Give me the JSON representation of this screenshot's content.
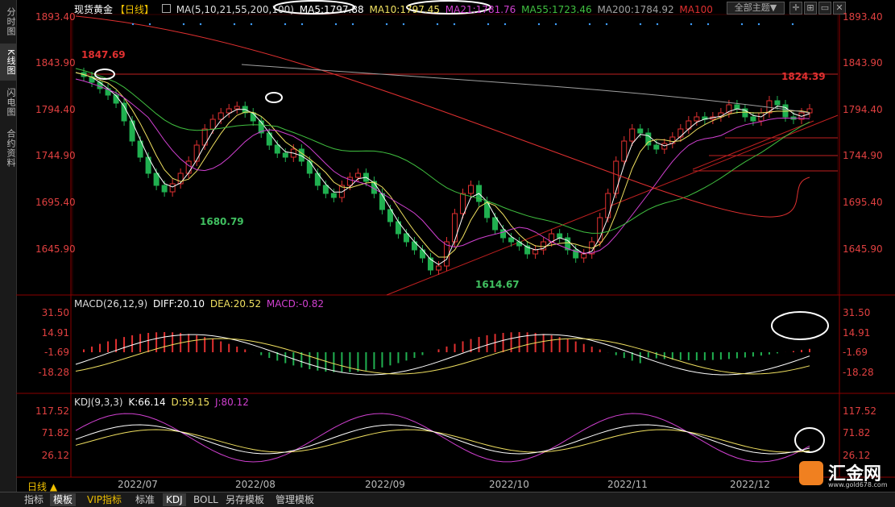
{
  "sidebar": {
    "tabs": [
      {
        "label": "分时图",
        "active": false
      },
      {
        "label": "K线图",
        "active": true
      },
      {
        "label": "闪电图",
        "active": false
      },
      {
        "label": "合约资料",
        "active": false
      }
    ]
  },
  "header": {
    "title": "现货黄金",
    "period_tag": "【日线】",
    "ma_label": "MA(5,10,21,55,200,100)",
    "ma5": "MA5:1797.88",
    "ma10": "MA10:1797.45",
    "ma21": "MA21:1781.76",
    "ma55": "MA55:1723.46",
    "ma200": "MA200:1784.92",
    "ma100": "MA100",
    "theme_button": "全部主题▼",
    "colors": {
      "ma5": "#ffffff",
      "ma10": "#f0e060",
      "ma21": "#d040d0",
      "ma55": "#40c040",
      "ma200": "#a0a0a0",
      "ma100": "#e03030"
    }
  },
  "price_axis": [
    "1893.40",
    "1843.90",
    "1794.40",
    "1744.90",
    "1695.40",
    "1645.90"
  ],
  "price_annotations": {
    "high1": "1847.69",
    "low1": "1680.79",
    "low2": "1614.67",
    "high2": "1824.39"
  },
  "macd": {
    "label": "MACD(26,12,9)",
    "diff": "DIFF:20.10",
    "dea": "DEA:20.52",
    "macd": "MACD:-0.82",
    "axis": [
      "31.50",
      "14.91",
      "-1.69",
      "-18.28"
    ]
  },
  "kdj": {
    "label": "KDJ(9,3,3)",
    "k": "K:66.14",
    "d": "D:59.15",
    "j": "J:80.12",
    "axis": [
      "117.52",
      "71.82",
      "26.12"
    ]
  },
  "dates": [
    "2022/07",
    "2022/08",
    "2022/09",
    "2022/10",
    "2022/11",
    "2022/12"
  ],
  "period": "日线 ▲",
  "bottom_tabs": [
    "指标",
    "模板",
    "VIP指标",
    "标准",
    "KDJ",
    "BOLL",
    "另存模板",
    "管理模板"
  ],
  "logo_text": "汇金网",
  "logo_url": "www.gold678.com"
}
